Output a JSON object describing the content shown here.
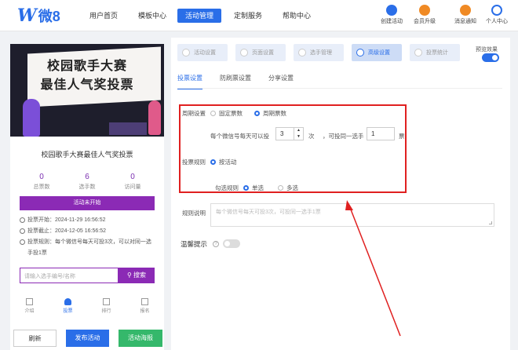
{
  "header": {
    "logo_mark": "W",
    "logo_text": "微8",
    "nav": [
      "用户首页",
      "模板中心",
      "活动管理",
      "定制服务",
      "帮助中心"
    ],
    "right": [
      "创建活动",
      "会员升级",
      "消息通知",
      "个人中心"
    ],
    "colors": {
      "brand": "#2a6ee8"
    }
  },
  "preview": {
    "banner_line1": "校园歌手大赛",
    "banner_line2": "最佳人气奖投票",
    "title": "校园歌手大赛最佳人气奖投票",
    "stats": [
      {
        "value": "0",
        "label": "总票数"
      },
      {
        "value": "6",
        "label": "选手数"
      },
      {
        "value": "0",
        "label": "访问量"
      }
    ],
    "status_button": "活动未开始",
    "vote_start": "投票开始：2024-11-29 16:56:52",
    "vote_end": "投票截止：2024-12-05 16:56:52",
    "vote_rule": "投票规则：每个微信号每天可投3次，可以对同一选手投1票",
    "search_placeholder": "请输入选手编号/名称",
    "search_button": "搜索",
    "tabbar": [
      "介绍",
      "投票",
      "排行",
      "报名"
    ],
    "theme_color": "#8b2ab5"
  },
  "actions": {
    "refresh": "刷新",
    "publish": "发布活动",
    "poster": "活动海报"
  },
  "panel": {
    "steps": [
      "活动设置",
      "页面设置",
      "选手管理",
      "高级设置",
      "投票统计"
    ],
    "preview_label": "预览效果",
    "subtabs": [
      "投票设置",
      "防刷票设置",
      "分享设置"
    ],
    "period_label": "周期设置",
    "period_options": [
      "固定票数",
      "周期票数"
    ],
    "per_day_prefix": "每个微信号每天可以投",
    "per_day_value": "3",
    "per_day_unit": "次",
    "same_prefix": "，可投同一选手",
    "same_value": "1",
    "same_unit": "票",
    "rule_label": "投票规则",
    "rule_option": "按活动",
    "check_label": "勾选规则",
    "check_options": [
      "单选",
      "多选"
    ],
    "desc_label": "规则说明",
    "desc_placeholder": "每个微信号每天可投3次，可投同一选手1票",
    "tip_label": "温馨提示",
    "highlight_color": "#e02020"
  }
}
